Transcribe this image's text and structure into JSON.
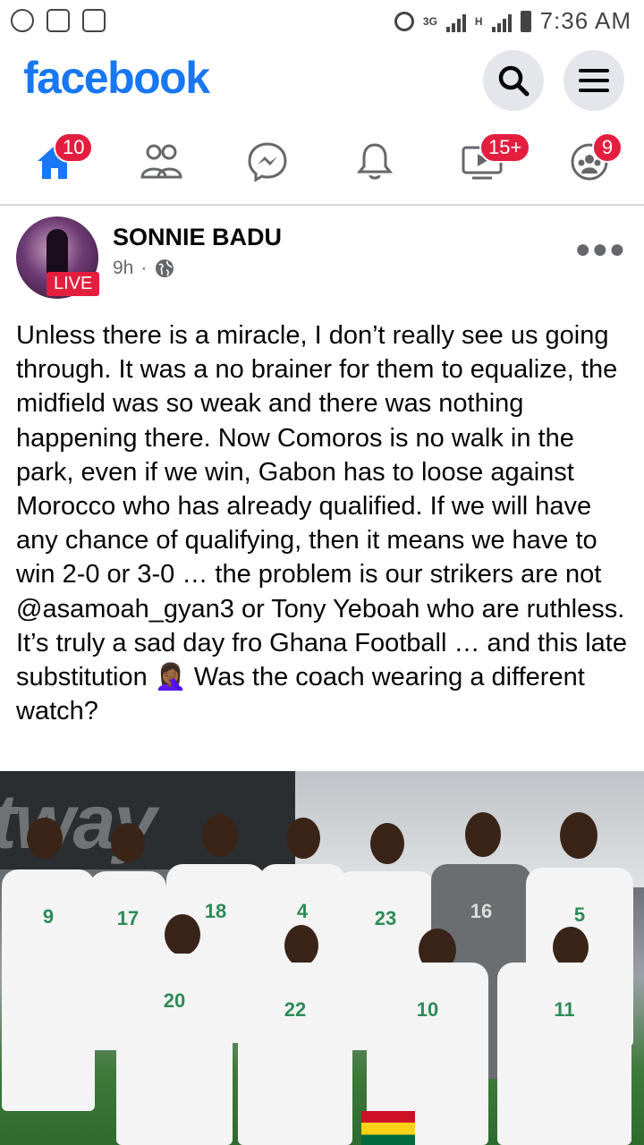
{
  "status_bar": {
    "time": "7:36 AM",
    "network_3g": "3G",
    "network_h": "H",
    "left_icons": [
      "whatsapp-icon",
      "gmail-icon",
      "gallery-icon"
    ]
  },
  "header": {
    "logo": "facebook",
    "brand_color": "#1877f2"
  },
  "tabs": [
    {
      "name": "home",
      "badge": "10"
    },
    {
      "name": "friends",
      "badge": ""
    },
    {
      "name": "messenger",
      "badge": ""
    },
    {
      "name": "notifications",
      "badge": ""
    },
    {
      "name": "watch",
      "badge": "15+"
    },
    {
      "name": "groups",
      "badge": "9"
    }
  ],
  "post": {
    "author": "SONNIE BADU",
    "live_label": "LIVE",
    "time": "9h",
    "separator": "·",
    "text": "Unless there is a miracle, I don’t really see us going through. It was a no brainer for them to equalize, the midfield was so weak and there was nothing happening there. Now Comoros is no walk in the park, even if we win, Gabon has to loose against Morocco who has already qualified. If we will have any chance of qualifying, then it means we have to win 2-0 or 3-0 … the problem is our strikers are not @asamoah_gyan3 or Tony Yeboah who are ruthless. It’s truly a sad day fro Ghana Football … and this late substitution 🤦🏾‍♀️ Was the coach wearing a different watch?"
  },
  "photo": {
    "banner_text": "tway",
    "jersey_numbers": [
      "9",
      "17",
      "18",
      "4",
      "23",
      "16",
      "5",
      "20",
      "22",
      "10",
      "11"
    ]
  }
}
